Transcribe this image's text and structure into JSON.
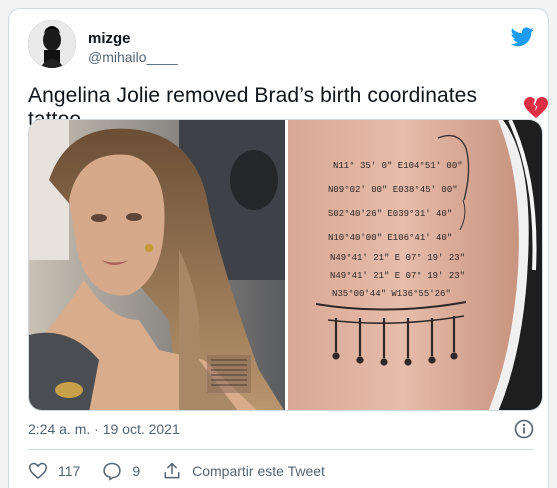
{
  "author": {
    "name": "mizge",
    "handle": "@mihailo____"
  },
  "tweet": {
    "text": "Angelina Jolie removed Brad’s birth coordinates tattoo"
  },
  "meta": {
    "timestamp": "2:24 a. m. · 19 oct. 2021"
  },
  "actions": {
    "likes": "117",
    "replies": "9",
    "share_label": "Compartir este Tweet"
  },
  "tattoo": {
    "lines": [
      "N11° 35' 0\"  E104°51' 00\"",
      "N09°02' 00\"  E038°45' 00\"",
      "S02°40'26\"  E039°31' 40\"",
      "N10°40'00\"  E106°41' 40\"",
      "N49°41' 21\"  E 07° 19' 23\"",
      "N49°41' 21\"  E 07° 19' 23\"",
      "N35°00'44\"  W136°55'26\""
    ]
  },
  "colors": {
    "twitter_blue": "#1d9bf0",
    "heart_red": "#dd2e44",
    "text_secondary": "#536471"
  }
}
